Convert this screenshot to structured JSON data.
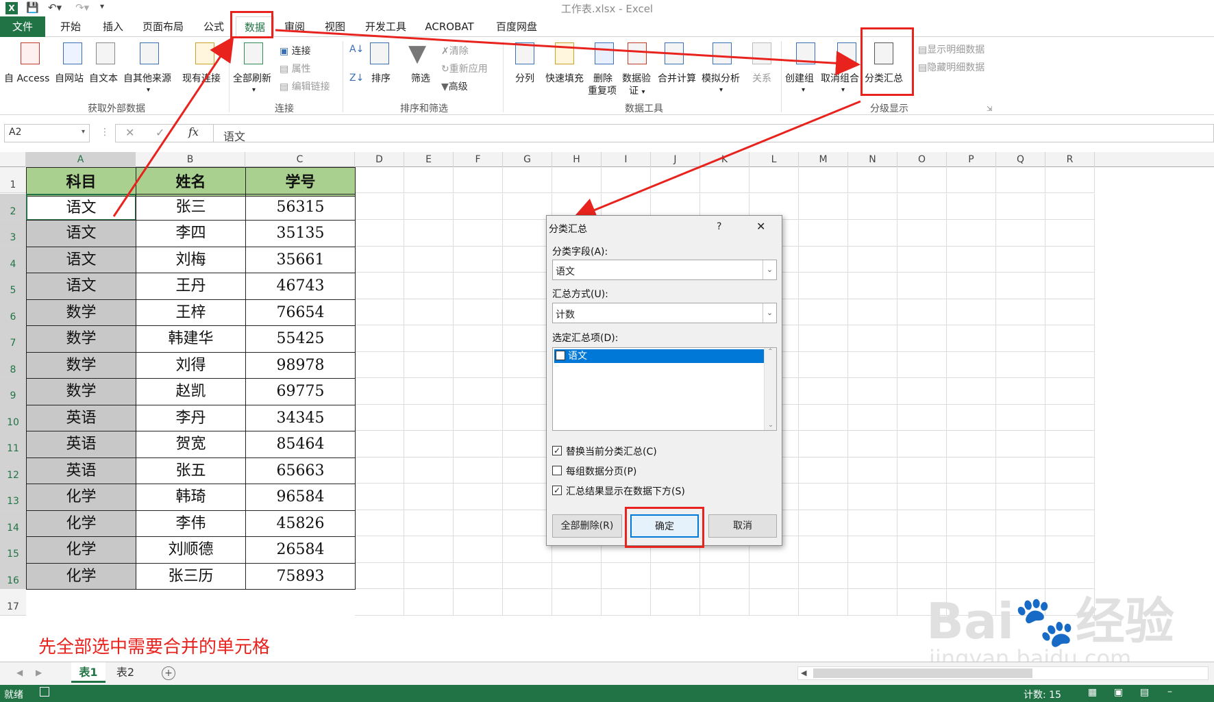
{
  "app": {
    "window_title": "工作表.xlsx - Excel",
    "quick_access": [
      "save-icon",
      "undo-icon",
      "redo-icon"
    ]
  },
  "tabs": [
    {
      "label": "文件",
      "active": false
    },
    {
      "label": "开始"
    },
    {
      "label": "插入"
    },
    {
      "label": "页面布局"
    },
    {
      "label": "公式"
    },
    {
      "label": "数据",
      "active": true
    },
    {
      "label": "审阅"
    },
    {
      "label": "视图"
    },
    {
      "label": "开发工具"
    },
    {
      "label": "ACROBAT"
    },
    {
      "label": "百度网盘"
    }
  ],
  "ribbon": {
    "external": {
      "access": "自 Access",
      "web": "自网站",
      "text": "自文本",
      "other": "自其他来源",
      "existing": "现有连接",
      "group": "获取外部数据"
    },
    "connections": {
      "refresh_all": "全部刷新",
      "connections": "连接",
      "properties": "属性",
      "edit_links": "编辑链接",
      "group": "连接"
    },
    "sort_filter": {
      "sort": "排序",
      "filter": "筛选",
      "clear": "清除",
      "reapply": "重新应用",
      "advanced": "高级",
      "group": "排序和筛选"
    },
    "data_tools": {
      "split": "分列",
      "flash_fill": "快速填充",
      "remove_dup_1": "删除",
      "remove_dup_2": "重复项",
      "validation_1": "数据验",
      "validation_2": "证",
      "consolidate": "合并计算",
      "what_if": "模拟分析",
      "relations": "关系",
      "group": "数据工具"
    },
    "outline": {
      "group_btn": "创建组",
      "ungroup": "取消组合",
      "subtotal": "分类汇总",
      "show_detail": "显示明细数据",
      "hide_detail": "隐藏明细数据",
      "group": "分级显示"
    }
  },
  "formula_bar": {
    "name_box": "A2",
    "fx": "fx",
    "value": "语文"
  },
  "columns": [
    "A",
    "B",
    "C",
    "D",
    "E",
    "F",
    "G",
    "H",
    "I",
    "J",
    "K",
    "L",
    "M",
    "N",
    "O",
    "P",
    "Q",
    "R"
  ],
  "rows": [
    "1",
    "2",
    "3",
    "4",
    "5",
    "6",
    "7",
    "8",
    "9",
    "10",
    "11",
    "12",
    "13",
    "14",
    "15",
    "16",
    "17"
  ],
  "table": {
    "headers": [
      "科目",
      "姓名",
      "学号"
    ],
    "rows": [
      [
        "语文",
        "张三",
        "56315"
      ],
      [
        "语文",
        "李四",
        "35135"
      ],
      [
        "语文",
        "刘梅",
        "35661"
      ],
      [
        "语文",
        "王丹",
        "46743"
      ],
      [
        "数学",
        "王梓",
        "76654"
      ],
      [
        "数学",
        "韩建华",
        "55425"
      ],
      [
        "数学",
        "刘得",
        "98978"
      ],
      [
        "数学",
        "赵凯",
        "69775"
      ],
      [
        "英语",
        "李丹",
        "34345"
      ],
      [
        "英语",
        "贺宽",
        "85464"
      ],
      [
        "英语",
        "张五",
        "65663"
      ],
      [
        "化学",
        "韩琦",
        "96584"
      ],
      [
        "化学",
        "李伟",
        "45826"
      ],
      [
        "化学",
        "刘顺德",
        "26584"
      ],
      [
        "化学",
        "张三历",
        "75893"
      ]
    ]
  },
  "annotation": "先全部选中需要合并的单元格",
  "dialog": {
    "title": "分类汇总",
    "help": "?",
    "close": "✕",
    "field_label": "分类字段(A):",
    "field_value": "语文",
    "method_label": "汇总方式(U):",
    "method_value": "计数",
    "items_label": "选定汇总项(D):",
    "items": [
      {
        "label": "语文",
        "checked": true
      }
    ],
    "opt_replace": "替换当前分类汇总(C)",
    "opt_replace_checked": true,
    "opt_pagebreak": "每组数据分页(P)",
    "opt_pagebreak_checked": false,
    "opt_below": "汇总结果显示在数据下方(S)",
    "opt_below_checked": true,
    "btn_remove_all": "全部删除(R)",
    "btn_ok": "确定",
    "btn_cancel": "取消"
  },
  "sheets": [
    "表1",
    "表2"
  ],
  "status": {
    "ready": "就绪",
    "count": "计数: 15"
  },
  "watermark": {
    "brand": "Bai",
    "brand_tail": "经验",
    "url": "jingyan.baidu.com"
  },
  "colors": {
    "excel_green": "#217346",
    "header_fill": "#a9d08e",
    "selection_fill": "#c8c8c8",
    "annotation_red": "#e8231e",
    "dialog_select": "#0078d7"
  }
}
